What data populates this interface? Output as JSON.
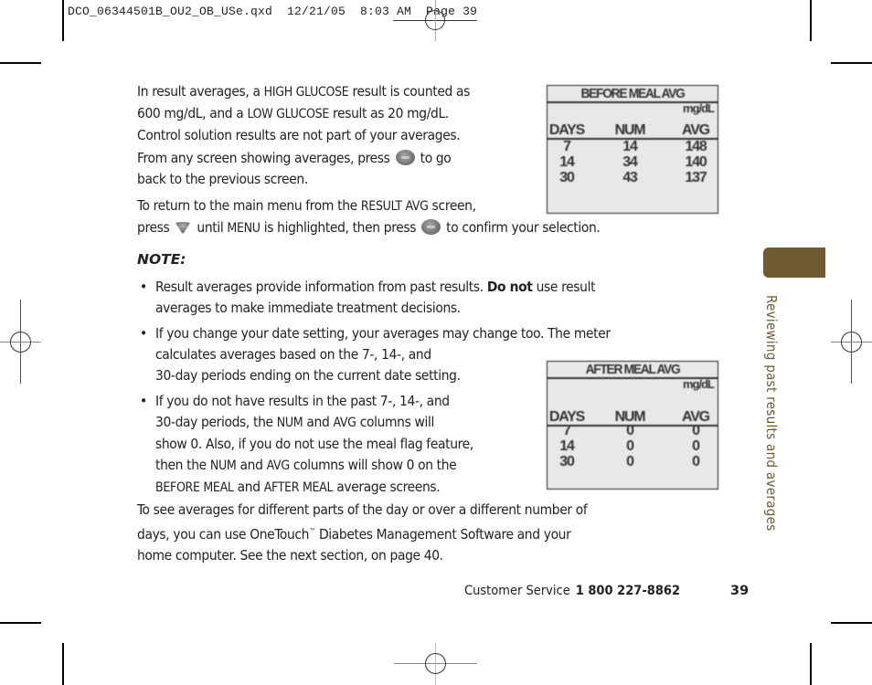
{
  "slug": {
    "text": "DCO_06344501B_OU2_OB_USe.qxd  12/21/05  8:03 AM  Page 39"
  },
  "paragraphs": {
    "p1": {
      "a": "In result averages, a ",
      "high": "HIGH GLUCOSE",
      "b": " result is counted as",
      "c": "600 mg/dL, and a ",
      "low": "LOW GLUCOSE",
      "d": " result as 20 mg/dL.",
      "e": "Control solution results are not part of your averages."
    },
    "p2": {
      "a": "From any screen showing averages, press ",
      "b": " to go",
      "c": "back to the previous screen."
    },
    "p3": {
      "a": "To return to the main menu from the ",
      "screen": "RESULT AVG",
      "b": " screen,",
      "c": "press ",
      "d": " until ",
      "menu": "MENU",
      "e": " is highlighted, then press ",
      "f": " to confirm your selection."
    },
    "note": "NOTE:",
    "bullets": {
      "b1": {
        "a": "Result averages provide information from past results. ",
        "bold": "Do not",
        "b": " use result",
        "c": "averages to make immediate treatment decisions."
      },
      "b2": {
        "a": "If you change your date setting, your averages may change too. The meter",
        "b": "calculates averages based on the 7-, 14-, and",
        "c": "30-day periods ending on the current date setting."
      },
      "b3": {
        "a": "If you do not have results in the past 7-, 14-, and",
        "b": "30-day periods, the ",
        "num1": "NUM",
        "c": " and ",
        "avg1": "AVG",
        "d": " columns will",
        "e": "show 0. Also, if you do not use the meal flag feature,",
        "f": "then the ",
        "num2": "NUM",
        "g": " and ",
        "avg2": "AVG",
        "h": " columns will show 0 on the",
        "before": "BEFORE MEAL",
        "i": " and ",
        "after": "AFTER MEAL",
        "j": " average screens."
      }
    },
    "p4": {
      "a": "To see averages for different parts of the day or over a different number of",
      "b": "days, you can use OneTouch",
      "tm": "™",
      "c": " Diabetes Management Software and your",
      "d": "home computer. See the next section, on page 40."
    }
  },
  "lcd_before": {
    "title": "BEFORE MEAL AVG",
    "unit": "mg/dL",
    "headers": [
      "DAYS",
      "NUM",
      "AVG"
    ],
    "rows": [
      [
        "7",
        "14",
        "148"
      ],
      [
        "14",
        "34",
        "140"
      ],
      [
        "30",
        "43",
        "137"
      ]
    ]
  },
  "lcd_after": {
    "title": "AFTER MEAL AVG",
    "unit": "mg/dL",
    "headers": [
      "DAYS",
      "NUM",
      "AVG"
    ],
    "rows": [
      [
        "7",
        "0",
        "0"
      ],
      [
        "14",
        "0",
        "0"
      ],
      [
        "30",
        "0",
        "0"
      ]
    ]
  },
  "side": {
    "label": "Reviewing past results and averages",
    "accent": "#6f5a33"
  },
  "footer": {
    "label": "Customer Service",
    "phone": "1 800 227-8862",
    "page": "39"
  },
  "icons": {
    "ok": "ok-button-icon",
    "down": "down-arrow-button-icon"
  }
}
